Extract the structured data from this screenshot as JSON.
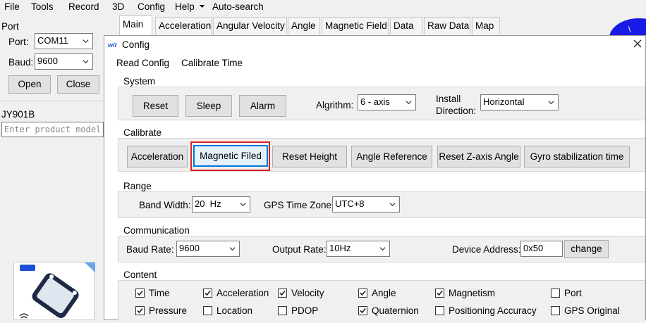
{
  "menubar": {
    "items": [
      "File",
      "Tools",
      "Record",
      "3D",
      "Config",
      "Help",
      "Auto-search"
    ]
  },
  "tabs": [
    "Main",
    "Acceleration",
    "Angular Velocity",
    "Angle",
    "Magnetic Field",
    "Data",
    "Raw Data",
    "Map"
  ],
  "left_panel": {
    "port_group": "Port",
    "port_label": "Port:",
    "port_value": "COM11",
    "baud_label": "Baud:",
    "baud_value": "9600",
    "open_button": "Open",
    "close_button": "Close",
    "device_label": "JY901B",
    "product_placeholder": "Enter product model"
  },
  "dialog": {
    "title": "Config",
    "menu": [
      "Read Config",
      "Calibrate Time"
    ],
    "system": {
      "title": "System",
      "reset": "Reset",
      "sleep": "Sleep",
      "alarm": "Alarm",
      "algorithm_label": "Algrithm:",
      "algorithm_value": "6 - axis",
      "install_label_1": "Install",
      "install_label_2": "Direction:",
      "install_value": "Horizontal"
    },
    "calibrate": {
      "title": "Calibrate",
      "buttons": [
        "Acceleration",
        "Magnetic Filed",
        "Reset Height",
        "Angle Reference",
        "Reset Z-axis Angle",
        "Gyro stabilization time"
      ],
      "highlighted": "Magnetic Filed"
    },
    "range": {
      "title": "Range",
      "bandwidth_label": "Band Width:",
      "bandwidth_value": "20  Hz",
      "gps_tz_label": "GPS Time Zone:",
      "gps_tz_value": "UTC+8"
    },
    "communication": {
      "title": "Communication",
      "baud_label": "Baud Rate:",
      "baud_value": "9600",
      "output_label": "Output Rate:",
      "output_value": "10Hz",
      "address_label": "Device Address:",
      "address_value": "0x50",
      "change_button": "change"
    },
    "content": {
      "title": "Content",
      "row1": [
        {
          "label": "Time",
          "checked": true
        },
        {
          "label": "Acceleration",
          "checked": true
        },
        {
          "label": "Velocity",
          "checked": true
        },
        {
          "label": "Angle",
          "checked": true
        },
        {
          "label": "Magnetism",
          "checked": true
        },
        {
          "label": "Port",
          "checked": false
        }
      ],
      "row2": [
        {
          "label": "Pressure",
          "checked": true
        },
        {
          "label": "Location",
          "checked": false
        },
        {
          "label": "PDOP",
          "checked": false
        },
        {
          "label": "Quaternion",
          "checked": true
        },
        {
          "label": "Positioning Accuracy",
          "checked": false
        },
        {
          "label": "GPS Original",
          "checked": false
        }
      ]
    }
  },
  "colors": {
    "highlight_red": "#e02020",
    "focus_blue": "#0078d7",
    "logo_blue": "#1a1ae6"
  }
}
